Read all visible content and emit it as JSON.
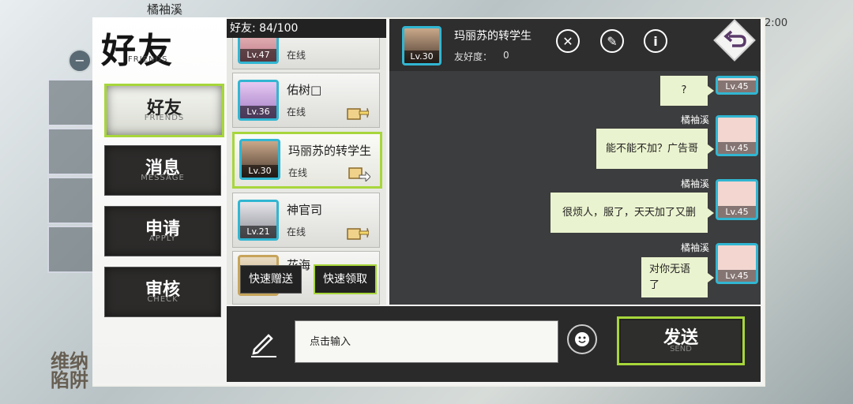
{
  "background": {
    "player_name": "橘袖溪",
    "time": "2:00"
  },
  "header": {
    "title": "好友",
    "title_en": "FRIENDS"
  },
  "nav": [
    {
      "label": "好友",
      "label_en": "FRIENDS",
      "active": true
    },
    {
      "label": "消息",
      "label_en": "MESSAGE",
      "active": false
    },
    {
      "label": "申请",
      "label_en": "APPLY",
      "active": false
    },
    {
      "label": "审核",
      "label_en": "CHECK",
      "active": false
    }
  ],
  "friend_list": {
    "header": "好友: 84/100",
    "items": [
      {
        "name": "",
        "level": "Lv.47",
        "status": "在线"
      },
      {
        "name": "佑树□",
        "level": "Lv.36",
        "status": "在线"
      },
      {
        "name": "玛丽苏的转学生",
        "level": "Lv.30",
        "status": "在线"
      },
      {
        "name": "神官司",
        "level": "Lv.21",
        "status": "在线"
      },
      {
        "name": "花海",
        "level": "",
        "status": ""
      }
    ],
    "quick_send": "快速赠送",
    "quick_receive": "快速领取"
  },
  "chat": {
    "partner_name": "玛丽苏的转学生",
    "partner_level": "Lv.30",
    "affinity_label": "友好度：",
    "affinity_value": "0",
    "messages": [
      {
        "sender": "",
        "text": "?",
        "level": "Lv.45"
      },
      {
        "sender": "橘袖溪",
        "text": "能不能不加？广告哥",
        "level": "Lv.45"
      },
      {
        "sender": "橘袖溪",
        "text": "很烦人，服了，天天加了又删",
        "level": "Lv.45"
      },
      {
        "sender": "橘袖溪",
        "text": "对你无语了",
        "level": "Lv.45"
      }
    ]
  },
  "input": {
    "placeholder": "点击输入",
    "send_label": "发送",
    "send_label_en": "SEND"
  },
  "colors": {
    "accent": "#a7d63a",
    "avatar_border": "#31b6d2",
    "bubble": "#eaf3cf",
    "dark_panel": "#3c3d3e"
  }
}
